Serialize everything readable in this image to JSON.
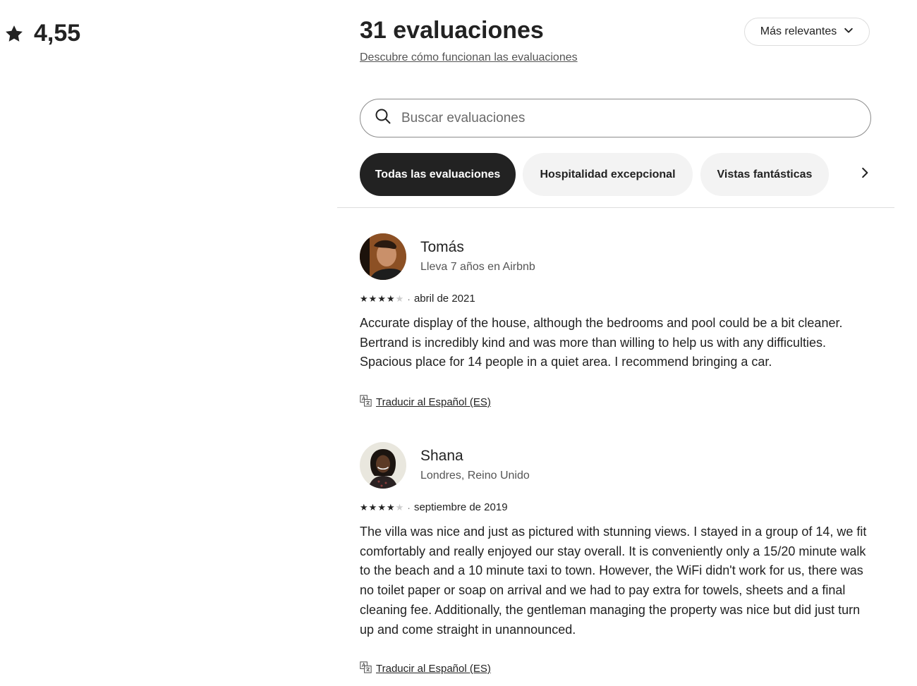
{
  "rating": {
    "value": "4,55",
    "icon": "star-icon"
  },
  "header": {
    "title": "31 evaluaciones",
    "how_link": "Descubre cómo funcionan las evaluaciones",
    "sort_label": "Más relevantes",
    "sort_icon": "chevron-down-icon"
  },
  "search": {
    "placeholder": "Buscar evaluaciones",
    "value": "",
    "icon": "search-icon"
  },
  "filters": {
    "chips": [
      {
        "label": "Todas las evaluaciones",
        "active": true
      },
      {
        "label": "Hospitalidad excepcional",
        "active": false
      },
      {
        "label": "Vistas fantásticas",
        "active": false
      }
    ],
    "next_icon": "chevron-right-icon"
  },
  "reviews": [
    {
      "name": "Tomás",
      "subtitle": "Lleva 7 años en Airbnb",
      "stars": 4,
      "date": "abril de 2021",
      "text_lines": [
        "Accurate display of the house, although the bedrooms and pool could be a bit cleaner. Bertrand is incredibly kind and was more than willing to help us with any difficulties.",
        "Spacious place for 14 people in a quiet area. I recommend bringing a car."
      ],
      "translate_label": "Traducir al Español (ES)",
      "avatar_icon": "avatar-photo"
    },
    {
      "name": "Shana",
      "subtitle": "Londres, Reino Unido",
      "stars": 4,
      "date": "septiembre de 2019",
      "text_lines": [
        "The villa was nice and just as pictured with stunning views. I stayed in a group of 14, we fit comfortably and really enjoyed our stay overall. It is conveniently only a 15/20 minute walk to the beach and a 10 minute taxi to town. However, the WiFi didn't work for us, there was no toilet paper or soap on arrival and we had to pay extra for towels, sheets and a final cleaning fee. Additionally, the gentleman managing the property was nice but did just turn up and come straight in unannounced."
      ],
      "translate_label": "Traducir al Español (ES)",
      "avatar_icon": "avatar-photo"
    }
  ],
  "colors": {
    "text": "#222222",
    "muted": "#555555",
    "chip_active_bg": "#222222",
    "chip_bg": "#f3f3f3",
    "border": "#dddddd"
  }
}
